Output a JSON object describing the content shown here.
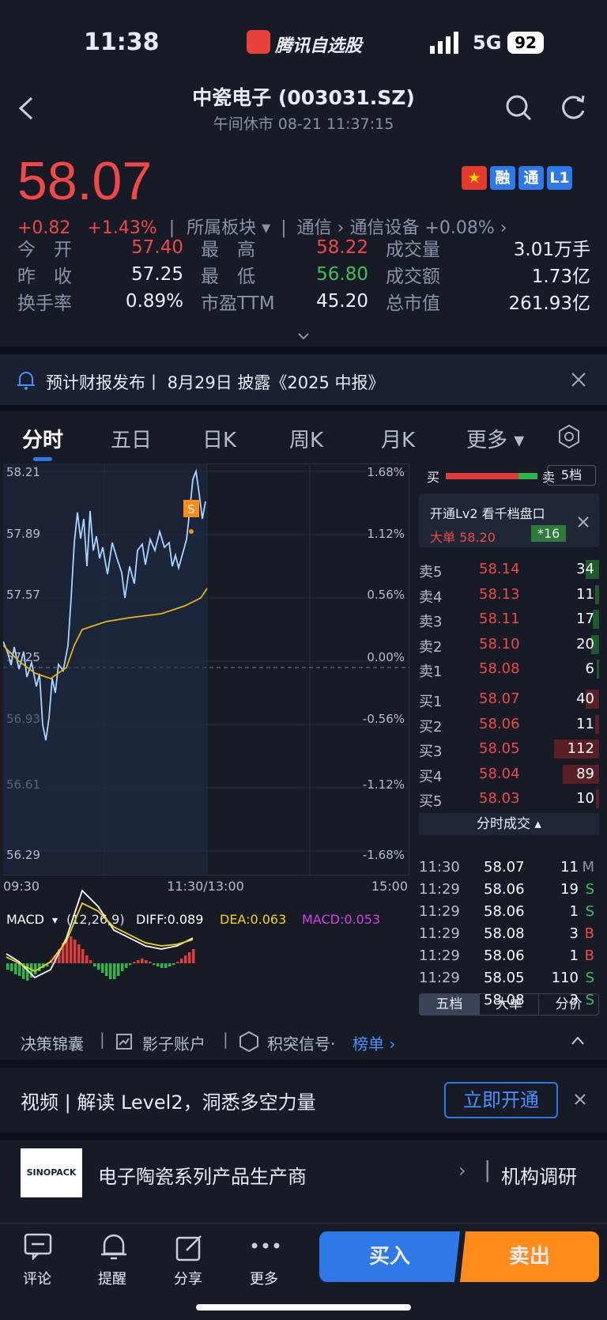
{
  "status": {
    "time": "11:38",
    "app_name": "腾讯自选股",
    "network": "5G",
    "battery": "92"
  },
  "header": {
    "title": "中瓷电子 (003031.SZ)",
    "subtitle": "午间休市   08-21 11:37:15"
  },
  "quote": {
    "price": "58.07",
    "change": "+0.82",
    "change_pct": "+1.43%",
    "sector_label": "所属板块",
    "sector1": "通信",
    "sector2": "通信设备 +0.08%",
    "badges": [
      "融",
      "通",
      "L1"
    ]
  },
  "stats": [
    {
      "l1": "今　开",
      "v1": "57.40",
      "l2": "最　高",
      "v2": "58.22",
      "l3": "成交量",
      "v3": "3.01万手"
    },
    {
      "l1": "昨　收",
      "v1": "57.25",
      "l2": "最　低",
      "v2": "56.80",
      "l3": "成交额",
      "v3": "1.73亿"
    },
    {
      "l1": "换手率",
      "v1": "0.89%",
      "l2": "市盈TTM",
      "v2": "45.20",
      "l3": "总市值",
      "v3": "261.93亿"
    }
  ],
  "notice": {
    "text": "预计财报发布丨 8月29日 披露《2025 中报》"
  },
  "tabs": [
    "分时",
    "五日",
    "日K",
    "周K",
    "月K",
    "更多"
  ],
  "chart": {
    "y_left": [
      "58.21",
      "57.89",
      "57.57",
      "57.25",
      "56.93",
      "56.61",
      "56.29"
    ],
    "y_right": [
      "1.68%",
      "1.12%",
      "0.56%",
      "0.00%",
      "-0.56%",
      "-1.12%",
      "-1.68%"
    ],
    "x": [
      "09:30",
      "11:30/13:00",
      "15:00"
    ],
    "macd_label": "MACD",
    "macd_params": "(12,26,9)",
    "diff": "DIFF:0.089",
    "dea": "DEA:0.063",
    "macd": "MACD:0.053",
    "marker": "S"
  },
  "orderbook": {
    "buy": "买",
    "sell": "卖",
    "level_btn": "5档",
    "promo": "开通Lv2 看千档盘口",
    "big_order": "大单 58.20",
    "big_count": "*16",
    "asks": [
      {
        "l": "卖5",
        "p": "58.14",
        "v": "34",
        "f": 0.2
      },
      {
        "l": "卖4",
        "p": "58.13",
        "v": "11",
        "f": 0.06
      },
      {
        "l": "卖3",
        "p": "58.11",
        "v": "17",
        "f": 0.09
      },
      {
        "l": "卖2",
        "p": "58.10",
        "v": "20",
        "f": 0.12
      },
      {
        "l": "卖1",
        "p": "58.08",
        "v": "6",
        "f": 0.03
      }
    ],
    "bids": [
      {
        "l": "买1",
        "p": "58.07",
        "v": "40",
        "f": 0.2
      },
      {
        "l": "买2",
        "p": "58.06",
        "v": "11",
        "f": 0.06
      },
      {
        "l": "买3",
        "p": "58.05",
        "v": "112",
        "f": 0.66
      },
      {
        "l": "买4",
        "p": "58.04",
        "v": "89",
        "f": 0.53
      },
      {
        "l": "买5",
        "p": "58.03",
        "v": "10",
        "f": 0.05
      }
    ],
    "trades_title": "分时成交",
    "trades": [
      {
        "t": "11:30",
        "p": "58.07",
        "v": "11",
        "s": "M"
      },
      {
        "t": "11:29",
        "p": "58.06",
        "v": "19",
        "s": "S"
      },
      {
        "t": "11:29",
        "p": "58.06",
        "v": "1",
        "s": "S"
      },
      {
        "t": "11:29",
        "p": "58.08",
        "v": "3",
        "s": "B"
      },
      {
        "t": "11:29",
        "p": "58.06",
        "v": "1",
        "s": "B"
      },
      {
        "t": "11:29",
        "p": "58.05",
        "v": "110",
        "s": "S"
      },
      {
        "t": "11:29",
        "p": "58.08",
        "v": "3",
        "s": "S"
      }
    ],
    "sub_tabs": [
      "五档",
      "大单",
      "分价"
    ]
  },
  "tools": {
    "t1": "决策锦囊",
    "t2": "影子账户",
    "t3": "积突信号·",
    "t4": "榜单"
  },
  "promo": {
    "text": "视频 | 解读 Level2，洞悉多空力量",
    "btn": "立即开通"
  },
  "company": {
    "logo": "SINOPACK",
    "desc": "电子陶瓷系列产品生产商",
    "right": "机构调研"
  },
  "bottom": {
    "comment": "评论",
    "remind": "提醒",
    "share": "分享",
    "more": "更多",
    "buy": "买入",
    "sell": "卖出"
  }
}
